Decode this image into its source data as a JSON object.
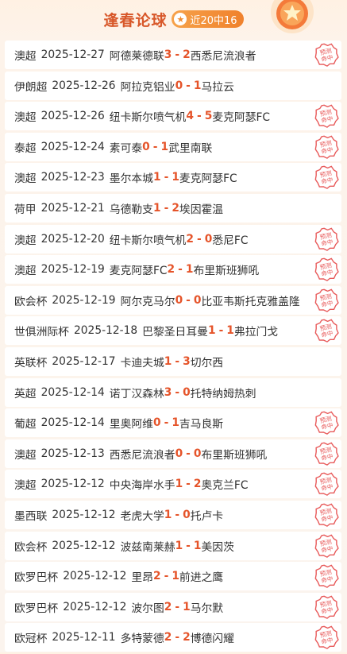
{
  "header": {
    "title": "逢春论球",
    "record": "近20中16",
    "star_icon": "star-icon",
    "medal_icon": "medal-icon"
  },
  "stamp_text": "预测命中",
  "colors": {
    "accent": "#e5542a",
    "title": "#d8582a",
    "badge": "#f0812c"
  },
  "matches": [
    {
      "league": "澳超",
      "date": "2025-12-27",
      "home": "阿德莱德联",
      "home_score": "3",
      "away_score": "2",
      "away": "西悉尼流浪者",
      "hit": true
    },
    {
      "league": "伊朗超",
      "date": "2025-12-26",
      "home": "阿拉克铝业",
      "home_score": "0",
      "away_score": "1",
      "away": "马拉云",
      "hit": false
    },
    {
      "league": "澳超",
      "date": "2025-12-26",
      "home": "纽卡斯尔喷气机",
      "home_score": "4",
      "away_score": "5",
      "away": "麦克阿瑟FC",
      "hit": true
    },
    {
      "league": "泰超",
      "date": "2025-12-24",
      "home": "素可泰",
      "home_score": "0",
      "away_score": "1",
      "away": "武里南联",
      "hit": true
    },
    {
      "league": "澳超",
      "date": "2025-12-23",
      "home": "墨尔本城",
      "home_score": "1",
      "away_score": "1",
      "away": "麦克阿瑟FC",
      "hit": true
    },
    {
      "league": "荷甲",
      "date": "2025-12-21",
      "home": "乌德勒支",
      "home_score": "1",
      "away_score": "2",
      "away": "埃因霍温",
      "hit": false
    },
    {
      "league": "澳超",
      "date": "2025-12-20",
      "home": "纽卡斯尔喷气机",
      "home_score": "2",
      "away_score": "0",
      "away": "悉尼FC",
      "hit": true
    },
    {
      "league": "澳超",
      "date": "2025-12-19",
      "home": "麦克阿瑟FC",
      "home_score": "2",
      "away_score": "1",
      "away": "布里斯班狮吼",
      "hit": true
    },
    {
      "league": "欧会杯",
      "date": "2025-12-19",
      "home": "阿尔克马尔",
      "home_score": "0",
      "away_score": "0",
      "away": "比亚韦斯托克雅盖隆",
      "hit": true
    },
    {
      "league": "世俱洲际杯",
      "date": "2025-12-18",
      "home": "巴黎圣日耳曼",
      "home_score": "1",
      "away_score": "1",
      "away": "弗拉门戈",
      "hit": true
    },
    {
      "league": "英联杯",
      "date": "2025-12-17",
      "home": "卡迪夫城",
      "home_score": "1",
      "away_score": "3",
      "away": "切尔西",
      "hit": false
    },
    {
      "league": "英超",
      "date": "2025-12-14",
      "home": "诺丁汉森林",
      "home_score": "3",
      "away_score": "0",
      "away": "托特纳姆热刺",
      "hit": false
    },
    {
      "league": "葡超",
      "date": "2025-12-14",
      "home": "里奥阿维",
      "home_score": "0",
      "away_score": "1",
      "away": "吉马良斯",
      "hit": true
    },
    {
      "league": "澳超",
      "date": "2025-12-13",
      "home": "西悉尼流浪者",
      "home_score": "0",
      "away_score": "0",
      "away": "布里斯班狮吼",
      "hit": true
    },
    {
      "league": "澳超",
      "date": "2025-12-12",
      "home": "中央海岸水手",
      "home_score": "1",
      "away_score": "2",
      "away": "奥克兰FC",
      "hit": true
    },
    {
      "league": "墨西联",
      "date": "2025-12-12",
      "home": "老虎大学",
      "home_score": "1",
      "away_score": "0",
      "away": "托卢卡",
      "hit": true
    },
    {
      "league": "欧会杯",
      "date": "2025-12-12",
      "home": "波兹南莱赫",
      "home_score": "1",
      "away_score": "1",
      "away": "美因茨",
      "hit": true
    },
    {
      "league": "欧罗巴杯",
      "date": "2025-12-12",
      "home": "里昂",
      "home_score": "2",
      "away_score": "1",
      "away": "前进之鹰",
      "hit": true
    },
    {
      "league": "欧罗巴杯",
      "date": "2025-12-12",
      "home": "波尔图",
      "home_score": "2",
      "away_score": "1",
      "away": "马尔默",
      "hit": true
    },
    {
      "league": "欧冠杯",
      "date": "2025-12-11",
      "home": "多特蒙德",
      "home_score": "2",
      "away_score": "2",
      "away": "博德闪耀",
      "hit": true
    }
  ]
}
